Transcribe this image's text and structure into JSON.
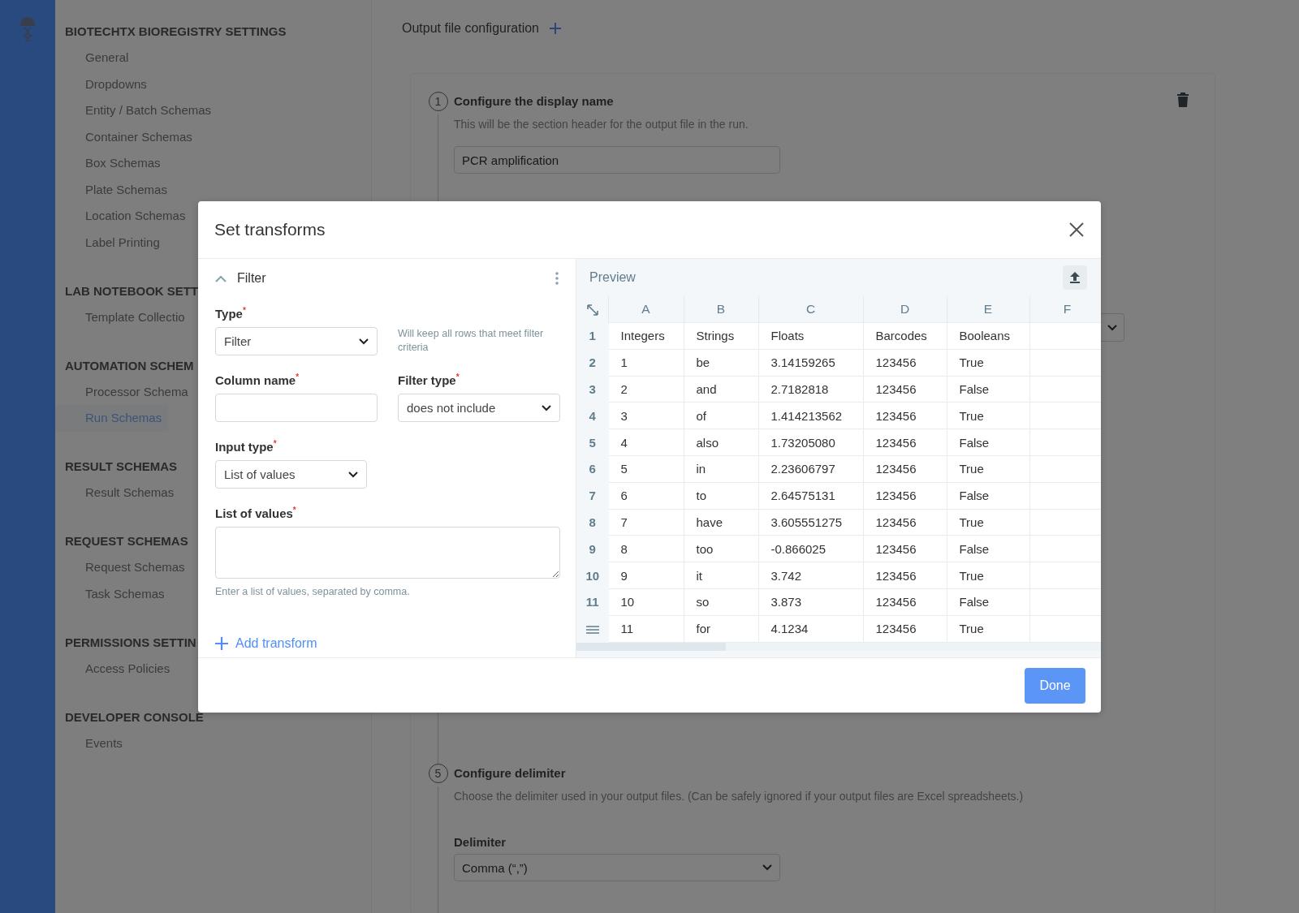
{
  "sidebar": {
    "sections": [
      {
        "heading": "BIOTECHTX BIOREGISTRY SETTINGS",
        "items": [
          {
            "label": "General",
            "selected": false
          },
          {
            "label": "Dropdowns",
            "selected": false
          },
          {
            "label": "Entity / Batch Schemas",
            "selected": false
          },
          {
            "label": "Container Schemas",
            "selected": false
          },
          {
            "label": "Box Schemas",
            "selected": false
          },
          {
            "label": "Plate Schemas",
            "selected": false
          },
          {
            "label": "Location Schemas",
            "selected": false
          },
          {
            "label": "Label Printing",
            "selected": false
          }
        ]
      },
      {
        "heading": "LAB NOTEBOOK SETT",
        "items": [
          {
            "label": "Template Collectio",
            "selected": false
          }
        ]
      },
      {
        "heading": "AUTOMATION SCHEM",
        "items": [
          {
            "label": "Processor Schema",
            "selected": false
          },
          {
            "label": "Run Schemas",
            "selected": true
          }
        ]
      },
      {
        "heading": "RESULT SCHEMAS",
        "items": [
          {
            "label": "Result Schemas",
            "selected": false
          }
        ]
      },
      {
        "heading": "REQUEST SCHEMAS",
        "items": [
          {
            "label": "Request Schemas",
            "selected": false
          },
          {
            "label": "Task Schemas",
            "selected": false
          }
        ]
      },
      {
        "heading": "PERMISSIONS SETTIN",
        "items": [
          {
            "label": "Access Policies",
            "selected": false
          }
        ]
      },
      {
        "heading": "DEVELOPER CONSOLE",
        "items": [
          {
            "label": "Events",
            "selected": false
          }
        ]
      }
    ]
  },
  "main": {
    "title": "Output file configuration",
    "steps": [
      {
        "number": "1",
        "title": "Configure the display name",
        "description": "This will be the section header for the output file in the run.",
        "input": {
          "value": "PCR amplification"
        }
      },
      {
        "number": "5",
        "title": "Configure delimiter",
        "description": "Choose the delimiter used in your output files. (Can be safely ignored if your output files are Excel spreadsheets.)",
        "label": "Delimiter",
        "select": {
          "value": "Comma (“,”)"
        }
      }
    ]
  },
  "modal": {
    "title": "Set transforms",
    "transform": {
      "title": "Filter",
      "expanded": true,
      "type": {
        "label": "Type$^{*}$",
        "value": "Filter",
        "hint": "Will keep all rows that meet filter criteria"
      },
      "column_name": {
        "label": "Column name$^{*}$"
      },
      "filter_type": {
        "label": "Filter type$^{*}$",
        "value": "does not include"
      },
      "input_type": {
        "label": "Input type$^{*}$",
        "value": "List of values"
      },
      "list_of_values": {
        "label": "List of values$^{*}$",
        "help": "Enter a list of values, separated by comma."
      }
    },
    "add_transform": "Add transform",
    "preview": {
      "title": "Preview",
      "columns": [
        "A",
        "B",
        "C",
        "D",
        "E",
        "F"
      ],
      "rows": [
        {
          "number": "1",
          "cells": [
            "Integers",
            "Strings",
            "Floats",
            "Barcodes",
            "Booleans"
          ]
        },
        {
          "number": "2",
          "cells": [
            "1",
            "be",
            "3.14159265",
            "123456",
            "True"
          ]
        },
        {
          "number": "3",
          "cells": [
            "2",
            "and",
            "2.7182818",
            "123456",
            "False"
          ]
        },
        {
          "number": "4",
          "cells": [
            "3",
            "of",
            "1.414213562",
            "123456",
            "True"
          ]
        },
        {
          "number": "5",
          "cells": [
            "4",
            "also",
            "1.73205080",
            "123456",
            "False"
          ]
        },
        {
          "number": "6",
          "cells": [
            "5",
            "in",
            "2.23606797",
            "123456",
            "True"
          ]
        },
        {
          "number": "7",
          "cells": [
            "6",
            "to",
            "2.64575131",
            "123456",
            "False"
          ]
        },
        {
          "number": "8",
          "cells": [
            "7",
            "have",
            "3.605551275",
            "123456",
            "True"
          ]
        },
        {
          "number": "9",
          "cells": [
            "8",
            "too",
            "-0.866025",
            "123456",
            "False"
          ]
        },
        {
          "number": "10",
          "cells": [
            "9",
            "it",
            "3.742",
            "123456",
            "True"
          ]
        },
        {
          "number": "11",
          "cells": [
            "10",
            "so",
            "3.873",
            "123456",
            "False"
          ]
        },
        {
          "cells": [
            "11",
            "for",
            "4.1234",
            "123456",
            "True"
          ]
        }
      ]
    },
    "done": "Done"
  }
}
